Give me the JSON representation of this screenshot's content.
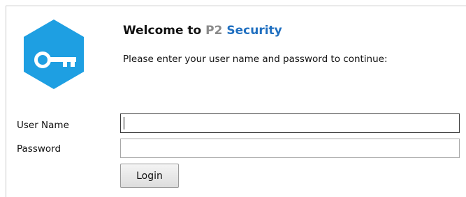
{
  "header": {
    "title_prefix": "Welcome to ",
    "title_brand_p2": "P2",
    "title_brand_security": " Security",
    "subtitle": "Please enter your user name and password to continue:"
  },
  "form": {
    "username_label": "User Name",
    "username_value": "",
    "password_label": "Password",
    "password_value": "",
    "login_label": "Login"
  },
  "colors": {
    "logo": "#1e9fe2",
    "brand_p2": "#8a8a8a",
    "brand_security": "#1f6fc0"
  },
  "icons": {
    "logo": "key-icon"
  }
}
